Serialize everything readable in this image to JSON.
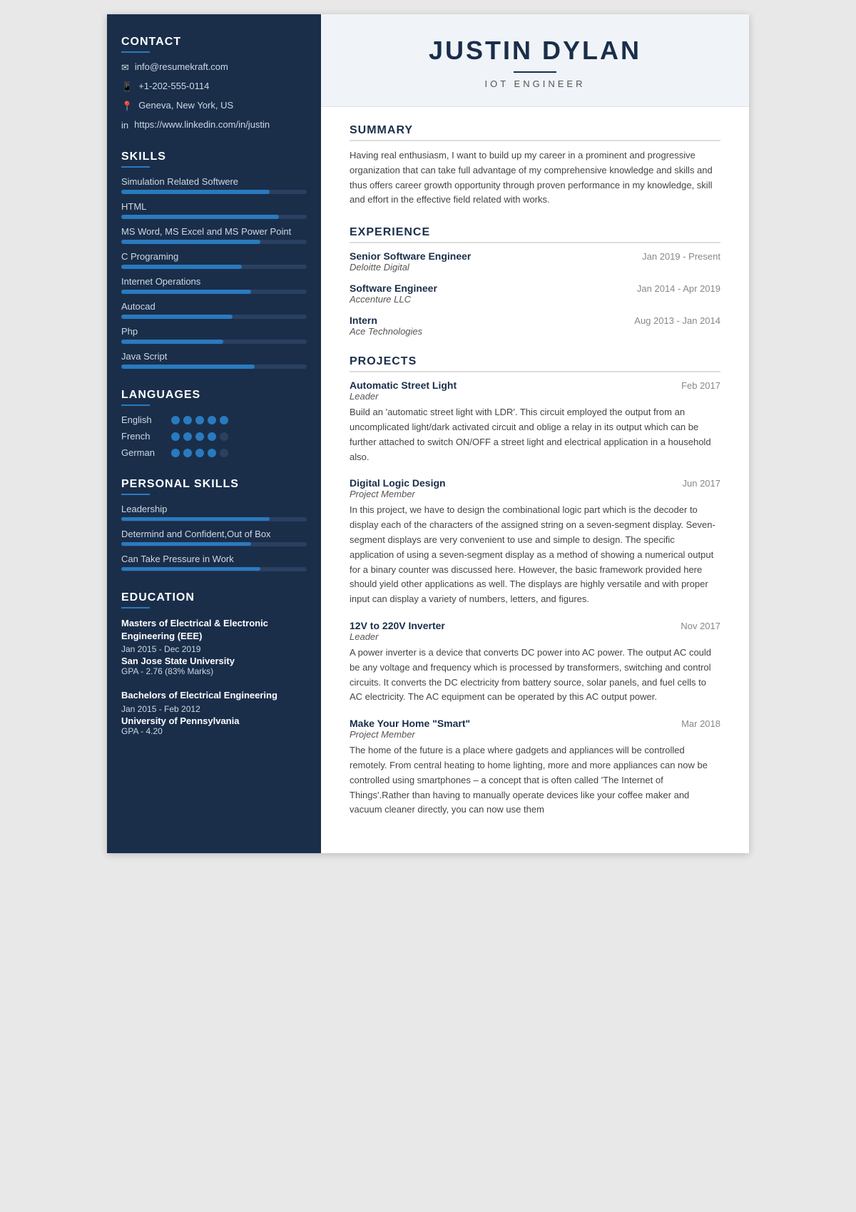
{
  "sidebar": {
    "contact": {
      "title": "CONTACT",
      "email": "info@resumekraft.com",
      "phone": "+1-202-555-0114",
      "location": "Geneva, New York, US",
      "linkedin": "https://www.linkedin.com/in/justin"
    },
    "skills": {
      "title": "SKILLS",
      "items": [
        {
          "name": "Simulation Related Softwere",
          "pct": 80
        },
        {
          "name": "HTML",
          "pct": 85
        },
        {
          "name": "MS Word, MS Excel and MS Power Point",
          "pct": 75
        },
        {
          "name": "C Programing",
          "pct": 65
        },
        {
          "name": "Internet Operations",
          "pct": 70
        },
        {
          "name": "Autocad",
          "pct": 60
        },
        {
          "name": "Php",
          "pct": 55
        },
        {
          "name": "Java Script",
          "pct": 72
        }
      ]
    },
    "languages": {
      "title": "LANGUAGES",
      "items": [
        {
          "name": "English",
          "dots": 5,
          "filled": 5
        },
        {
          "name": "French",
          "dots": 5,
          "filled": 4
        },
        {
          "name": "German",
          "dots": 5,
          "filled": 4
        }
      ]
    },
    "personal_skills": {
      "title": "PERSONAL SKILLS",
      "items": [
        {
          "name": "Leadership",
          "pct": 80
        },
        {
          "name": "Determind and Confident,Out of Box",
          "pct": 70
        },
        {
          "name": "Can Take Pressure in Work",
          "pct": 75
        }
      ]
    },
    "education": {
      "title": "EDUCATION",
      "items": [
        {
          "degree": "Masters of Electrical & Electronic Engineering (EEE)",
          "date": "Jan 2015 - Dec 2019",
          "university": "San Jose State University",
          "gpa": "GPA - 2.76 (83% Marks)"
        },
        {
          "degree": "Bachelors of Electrical Engineering",
          "date": "Jan 2015 - Feb 2012",
          "university": "University of Pennsylvania",
          "gpa": "GPA - 4.20"
        }
      ]
    }
  },
  "main": {
    "name": "JUSTIN DYLAN",
    "title": "IOT ENGINEER",
    "summary": {
      "title": "SUMMARY",
      "text": "Having real enthusiasm, I want to build up my career in a prominent and progressive organization that can take full advantage of my comprehensive knowledge and skills and thus offers career growth opportunity through proven performance in my knowledge, skill and effort in the effective field related with works."
    },
    "experience": {
      "title": "EXPERIENCE",
      "items": [
        {
          "role": "Senior Software Engineer",
          "company": "Deloitte Digital",
          "date": "Jan 2019 - Present"
        },
        {
          "role": "Software Engineer",
          "company": "Accenture LLC",
          "date": "Jan 2014 - Apr 2019"
        },
        {
          "role": "Intern",
          "company": "Ace Technologies",
          "date": "Aug 2013 - Jan 2014"
        }
      ]
    },
    "projects": {
      "title": "PROJECTS",
      "items": [
        {
          "name": "Automatic Street Light Leader",
          "name_line1": "Automatic Street Light",
          "name_line2": "Leader",
          "date": "Feb 2017",
          "role": "Leader",
          "desc": "Build an 'automatic street light with LDR'. This circuit employed the output from an uncomplicated light/dark activated circuit and oblige a relay in its output which can be further attached to switch ON/OFF a street light and electrical application in a household also."
        },
        {
          "name": "Digital Logic Design",
          "name_line1": "Digital Logic Design",
          "name_line2": "Project Member",
          "date": "Jun 2017",
          "role": "Project Member",
          "desc": "In this project, we have to design the combinational logic part which is the decoder to display each of the characters of the assigned string on a seven-segment display. Seven-segment displays are very convenient to use and simple to design. The specific application of using a seven-segment display as a method of showing a numerical output for a binary counter was discussed here. However, the basic framework provided here should yield other applications as well. The displays are highly versatile and with proper input can display a variety of numbers, letters, and figures."
        },
        {
          "name": "12V to 220V Inverter",
          "name_line1": "12V to 220V Inverter",
          "name_line2": "Leader",
          "date": "Nov 2017",
          "role": "Leader",
          "desc": "A power inverter is a device that converts DC power into AC power. The output AC could be any voltage and frequency which is processed by transformers, switching and control circuits. It converts the DC electricity from battery source, solar panels, and fuel cells to AC electricity. The AC equipment can be operated by this AC output power."
        },
        {
          "name": "Make Your Home \"Smart\"",
          "name_line1": "Make Your Home \"Smart\"",
          "name_line2": "Project Member",
          "date": "Mar 2018",
          "role": "Project Member",
          "desc": "The home of the future is a place where gadgets and appliances will be controlled remotely. From central heating to home lighting, more and more appliances can now be controlled using smartphones – a concept that is often called 'The Internet of Things'.Rather than having to manually operate devices like your coffee maker and vacuum cleaner directly, you can now use them"
        }
      ]
    }
  }
}
